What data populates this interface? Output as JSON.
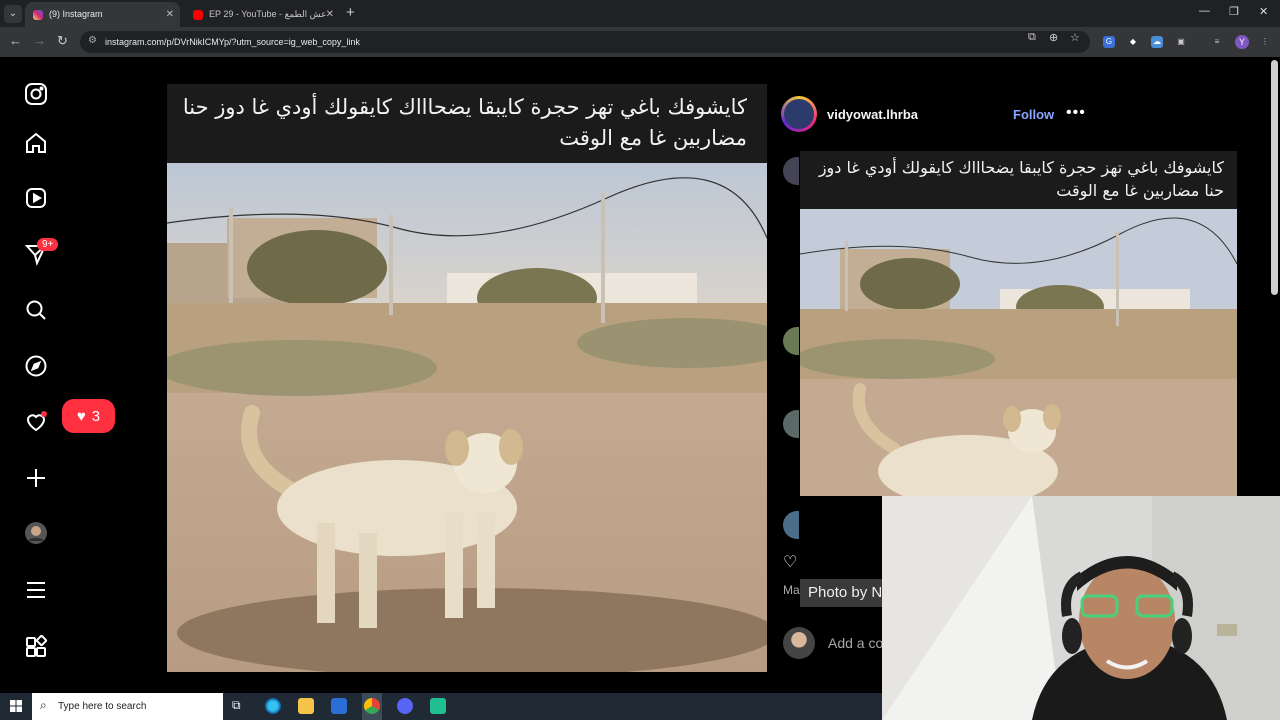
{
  "browser": {
    "tabs": [
      {
        "title": "(9) Instagram",
        "active": true
      },
      {
        "title": "EP 29 - YouTube - عش الطمع",
        "active": false
      }
    ],
    "url": "instagram.com/p/DVrNikICMYp/?utm_source=ig_web_copy_link",
    "profile_initial": "Y"
  },
  "sidebar": {
    "notification_badge": "9+",
    "likes_count": "3"
  },
  "post": {
    "caption": "كايشوفك باغي تهز حجرة كايبقا يضحاااك كايقولك أودي غا دوز حنا مضاربين غا مع الوقت",
    "username": "vidyowat.lhrba",
    "follow_label": "Follow",
    "more_label": "•••",
    "photo_by": "Photo by N",
    "add_comment": "Add a co",
    "side_label": "Ma"
  },
  "taskbar": {
    "search_placeholder": "Type here to search"
  }
}
